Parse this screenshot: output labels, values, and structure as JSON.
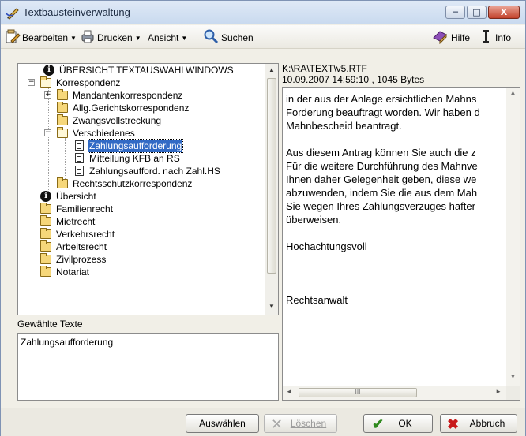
{
  "window": {
    "title": "Textbausteinverwaltung",
    "minimize_label": "─",
    "maximize_label": "□",
    "close_label": "X"
  },
  "toolbar": {
    "bearbeiten": "Bearbeiten",
    "drucken": "Drucken",
    "ansicht": "Ansicht",
    "suchen": "Suchen",
    "hilfe": "Hilfe",
    "info": "Info"
  },
  "tree": {
    "items": [
      {
        "label": "ÜBERSICHT TEXTAUSWAHLWINDOWS",
        "icon": "info-icon"
      },
      {
        "label": "Korrespondenz",
        "icon": "folder-open-icon"
      },
      {
        "label": "Mandantenkorrespondenz",
        "icon": "folder-icon"
      },
      {
        "label": "Allg.Gerichtskorrespondenz",
        "icon": "folder-icon"
      },
      {
        "label": "Zwangsvollstreckung",
        "icon": "folder-icon"
      },
      {
        "label": "Verschiedenes",
        "icon": "folder-open-icon"
      },
      {
        "label": "Zahlungsaufforderung",
        "icon": "document-icon"
      },
      {
        "label": "Mitteilung KFB an RS",
        "icon": "document-icon"
      },
      {
        "label": "Zahlungsaufford. nach Zahl.HS",
        "icon": "document-icon"
      },
      {
        "label": "Rechtsschutzkorrespondenz",
        "icon": "folder-icon"
      },
      {
        "label": "Übersicht",
        "icon": "info-icon"
      },
      {
        "label": "Familienrecht",
        "icon": "folder-icon"
      },
      {
        "label": "Mietrecht",
        "icon": "folder-icon"
      },
      {
        "label": "Verkehrsrecht",
        "icon": "folder-icon"
      },
      {
        "label": "Arbeitsrecht",
        "icon": "folder-icon"
      },
      {
        "label": "Zivilprozess",
        "icon": "folder-icon"
      },
      {
        "label": "Notariat",
        "icon": "folder-icon"
      }
    ]
  },
  "selected": {
    "label": "Gewählte Texte",
    "items": [
      "Zahlungsaufforderung"
    ]
  },
  "file": {
    "path": "K:\\RA\\TEXT\\v5.RTF",
    "info": "10.09.2007 14:59:10 , 1045 Bytes"
  },
  "preview": {
    "lines": [
      "in der aus der Anlage ersichtlichen Mahns",
      "Forderung beauftragt worden. Wir haben d",
      "Mahnbescheid beantragt.",
      "",
      "Aus diesem Antrag können Sie auch die z",
      "Für die weitere Durchführung des Mahnve",
      "Ihnen daher Gelegenheit geben, diese we",
      "abzuwenden, indem Sie die aus dem Mah",
      "Sie wegen Ihres Zahlungsverzuges hafter",
      "überweisen.",
      "",
      "Hochachtungsvoll",
      "",
      "",
      "",
      "Rechtsanwalt"
    ],
    "hscroll_grip": "III"
  },
  "buttons": {
    "auswaehlen": "Auswählen",
    "loeschen": "Löschen",
    "ok": "OK",
    "abbruch": "Abbruch"
  },
  "colors": {
    "selection": "#316ac5",
    "ok_check": "#2f8a1e",
    "cancel_x": "#c8191a"
  }
}
